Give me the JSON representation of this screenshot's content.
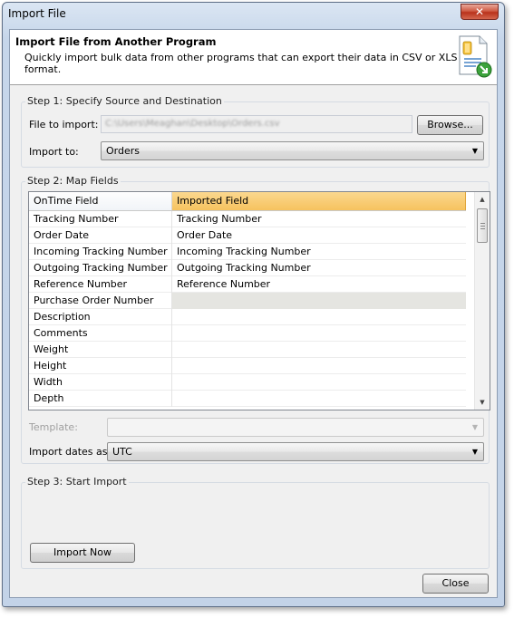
{
  "window": {
    "title": "Import File",
    "close_glyph": "✕"
  },
  "header": {
    "title": "Import File from Another Program",
    "subtitle": "Quickly import bulk data from other programs that can export their data in CSV or XLS format.",
    "icon": "import-document-icon"
  },
  "step1": {
    "title": "Step 1: Specify Source and Destination",
    "file_label": "File to import:",
    "file_value": "C:\\Users\\Meaghan\\Desktop\\Orders.csv",
    "browse_label": "Browse...",
    "import_to_label": "Import to:",
    "import_to_value": "Orders"
  },
  "step2": {
    "title": "Step 2: Map Fields",
    "columns": [
      "OnTime Field",
      "Imported Field"
    ],
    "rows": [
      {
        "field": "Tracking Number",
        "imported": "Tracking Number"
      },
      {
        "field": "Order Date",
        "imported": "Order Date"
      },
      {
        "field": "Incoming Tracking Number",
        "imported": "Incoming Tracking Number"
      },
      {
        "field": "Outgoing Tracking Number",
        "imported": "Outgoing Tracking Number"
      },
      {
        "field": "Reference Number",
        "imported": "Reference Number"
      },
      {
        "field": "Purchase Order Number",
        "imported": ""
      },
      {
        "field": "Description",
        "imported": ""
      },
      {
        "field": "Comments",
        "imported": ""
      },
      {
        "field": "Weight",
        "imported": ""
      },
      {
        "field": "Height",
        "imported": ""
      },
      {
        "field": "Width",
        "imported": ""
      },
      {
        "field": "Depth",
        "imported": ""
      }
    ],
    "template_label": "Template:",
    "template_value": "",
    "dates_label": "Import dates as:",
    "dates_value": "UTC"
  },
  "step3": {
    "title": "Step 3: Start Import",
    "import_button": "Import Now"
  },
  "footer": {
    "close_button": "Close"
  },
  "colors": {
    "header_highlight": "#f6c25e",
    "selected_cell": "#e5e5e1"
  }
}
